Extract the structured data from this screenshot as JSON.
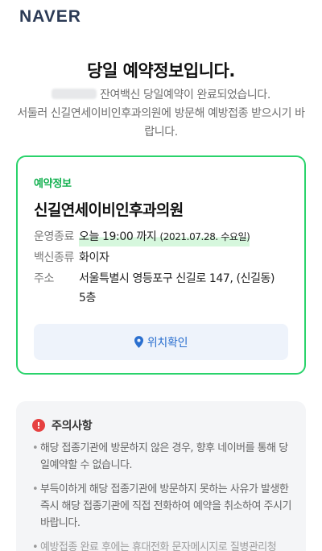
{
  "header": {
    "logo": "NAVER"
  },
  "title": "당일 예약정보입니다.",
  "intro": {
    "line1": "잔여백신 당일예약이 완료되었습니다.",
    "line2": "서둘러 신길연세이비인후과의원에 방문해 예방접종 받으시기 바랍니다."
  },
  "reservation": {
    "tag": "예약정보",
    "clinic_name": "신길연세이비인후과의원",
    "hours_label": "운영종료",
    "hours_value": "오늘 19:00 까지",
    "hours_date": "(2021.07.28. 수요일)",
    "vaccine_label": "백신종류",
    "vaccine_value": "화이자",
    "address_label": "주소",
    "address_value": "서울특별시 영등포구 신길로 147, (신길동) 5층",
    "location_button": "위치확인",
    "accent_color": "#2ad36b"
  },
  "notice": {
    "icon": "alert-icon",
    "title": "주의사항",
    "items": [
      "해당 접종기관에 방문하지 않은 경우, 향후 네이버를 통해 당일예약할 수 없습니다.",
      "부득이하게 해당 접종기관에 방문하지 못하는 사유가 발생한 즉시 해당 접종기관에 직접 전화하여 예약을 취소하여 주시기 바랍니다.",
      "예방접종 완료 후에는 휴대전화 문자메시지로 질병관리청"
    ]
  }
}
